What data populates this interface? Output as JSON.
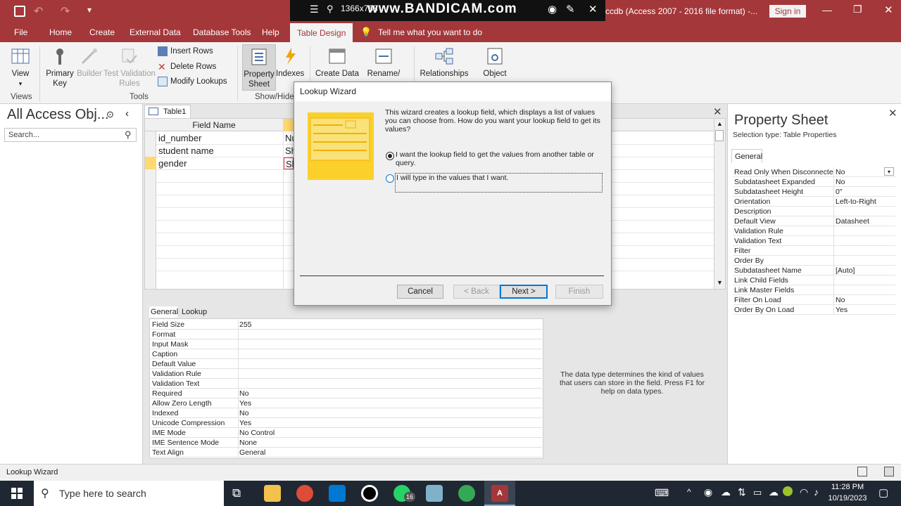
{
  "app": {
    "title": "ccdb (Access 2007 - 2016 file format)  -...",
    "signin": "Sign in",
    "watermark": "www.BANDICAM.com",
    "resolution": "1366x768"
  },
  "tabs": [
    "File",
    "Home",
    "Create",
    "External Data",
    "Database Tools",
    "Help",
    "Table Design"
  ],
  "tellme": "Tell me what you want to do",
  "ribbon": {
    "view": "View",
    "primary_key_1": "Primary",
    "primary_key_2": "Key",
    "builder": "Builder",
    "test_validation_1": "Test Validation",
    "test_validation_2": "Rules",
    "insert_rows": "Insert Rows",
    "delete_rows": "Delete Rows",
    "modify_lookups": "Modify Lookups",
    "property_sheet_1": "Property",
    "property_sheet_2": "Sheet",
    "indexes": "Indexes",
    "create_data": "Create Data",
    "rename": "Rename/",
    "relationships": "Relationships",
    "object": "Object",
    "group_views": "Views",
    "group_tools": "Tools",
    "group_showhide": "Show/Hide"
  },
  "nav": {
    "title": "All Access Obj...",
    "search_placeholder": "Search..."
  },
  "table": {
    "tab": "Table1",
    "col_field_name": "Field Name",
    "rows": [
      {
        "name": "id_number",
        "type": "Nu"
      },
      {
        "name": "student name",
        "type": "Sh"
      },
      {
        "name": "gender",
        "type": "Sh"
      }
    ]
  },
  "field_props": {
    "tab_general": "General",
    "tab_lookup": "Lookup",
    "rows": [
      [
        "Field Size",
        "255"
      ],
      [
        "Format",
        ""
      ],
      [
        "Input Mask",
        ""
      ],
      [
        "Caption",
        ""
      ],
      [
        "Default Value",
        ""
      ],
      [
        "Validation Rule",
        ""
      ],
      [
        "Validation Text",
        ""
      ],
      [
        "Required",
        "No"
      ],
      [
        "Allow Zero Length",
        "Yes"
      ],
      [
        "Indexed",
        "No"
      ],
      [
        "Unicode Compression",
        "Yes"
      ],
      [
        "IME Mode",
        "No Control"
      ],
      [
        "IME Sentence Mode",
        "None"
      ],
      [
        "Text Align",
        "General"
      ]
    ],
    "help": "The data type determines the kind of values that users can store in the field. Press F1 for help on data types."
  },
  "property_sheet": {
    "title": "Property Sheet",
    "selection_type": "Selection type:  Table Properties",
    "tab": "General",
    "rows": [
      [
        "Read Only When Disconnecte",
        "No"
      ],
      [
        "Subdatasheet Expanded",
        "No"
      ],
      [
        "Subdatasheet Height",
        "0\""
      ],
      [
        "Orientation",
        "Left-to-Right"
      ],
      [
        "Description",
        ""
      ],
      [
        "Default View",
        "Datasheet"
      ],
      [
        "Validation Rule",
        ""
      ],
      [
        "Validation Text",
        ""
      ],
      [
        "Filter",
        ""
      ],
      [
        "Order By",
        ""
      ],
      [
        "Subdatasheet Name",
        "[Auto]"
      ],
      [
        "Link Child Fields",
        ""
      ],
      [
        "Link Master Fields",
        ""
      ],
      [
        "Filter On Load",
        "No"
      ],
      [
        "Order By On Load",
        "Yes"
      ]
    ]
  },
  "dialog": {
    "title": "Lookup Wizard",
    "intro": "This wizard creates a lookup field, which displays a list of values you can choose from.  How do you want your lookup field to get its values?",
    "option1": "I want the lookup field to get the values from another table or query.",
    "option2": "I will type in the values that I want.",
    "cancel": "Cancel",
    "back": "< Back",
    "next": "Next >",
    "finish": "Finish"
  },
  "status": "Lookup Wizard",
  "taskbar": {
    "search": "Type here to search",
    "time": "11:28 PM",
    "date": "10/19/2023",
    "whatsapp_badge": "16"
  },
  "colors": {
    "accent": "#a4373a",
    "taskbar": "#1f2733",
    "selected_row": "#ffd870"
  }
}
